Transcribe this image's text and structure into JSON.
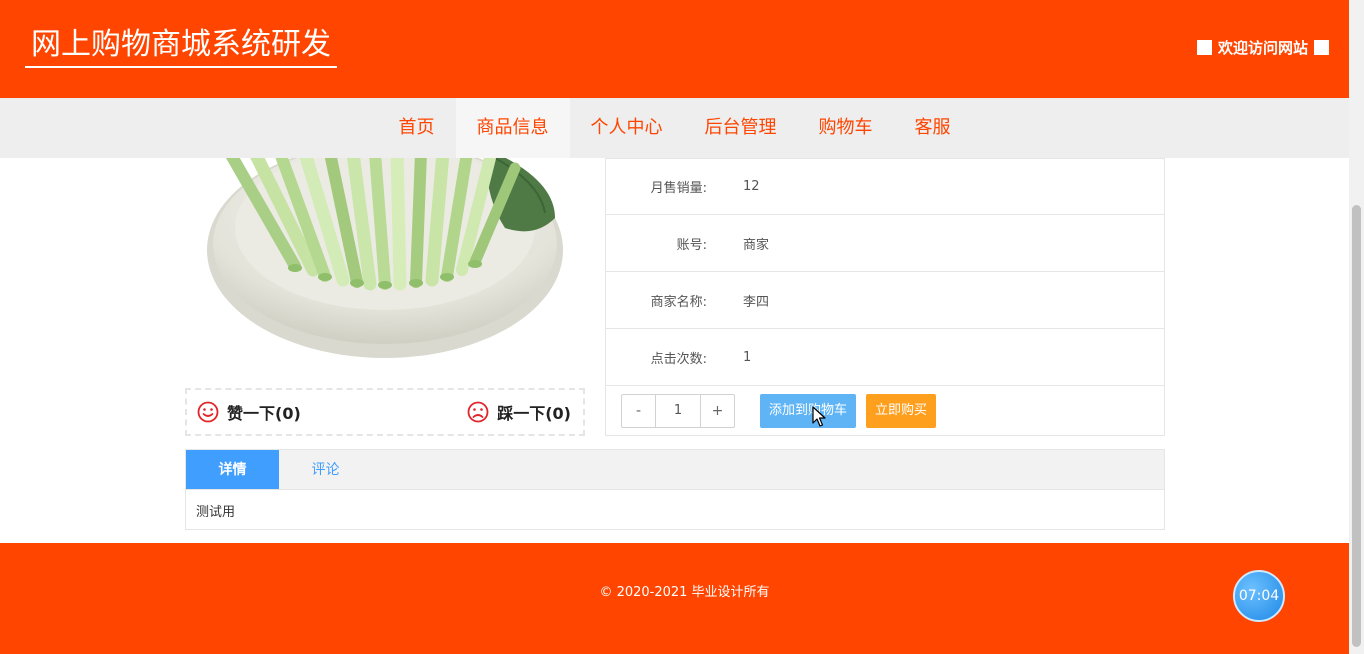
{
  "header": {
    "site_title": "网上购物商城系统研发",
    "welcome": "欢迎访问网站"
  },
  "nav": {
    "items": [
      {
        "label": "首页"
      },
      {
        "label": "商品信息"
      },
      {
        "label": "个人中心"
      },
      {
        "label": "后台管理"
      },
      {
        "label": "购物车"
      },
      {
        "label": "客服"
      }
    ],
    "active_index": 1
  },
  "product": {
    "image_icon": "bok-choy-photo",
    "likes_label": "赞一下(0)",
    "dislikes_label": "踩一下(0)",
    "info": [
      {
        "label": "月售销量:",
        "value": "12"
      },
      {
        "label": "账号:",
        "value": "商家"
      },
      {
        "label": "商家名称:",
        "value": "李四"
      },
      {
        "label": "点击次数:",
        "value": "1"
      }
    ],
    "quantity": {
      "minus": "-",
      "value": "1",
      "plus": "+"
    },
    "add_to_cart": "添加到购物车",
    "buy_now": "立即购买"
  },
  "tabs": {
    "items": [
      {
        "label": "详情"
      },
      {
        "label": "评论"
      }
    ],
    "active_index": 0,
    "content": "测试用"
  },
  "footer": {
    "copyright": "© 2020-2021 毕业设计所有"
  },
  "clock": {
    "time": "07:04"
  },
  "colors": {
    "brand": "#ff4500",
    "tab_active": "#409eff",
    "cart_button": "#5fb4f5",
    "buy_button": "#ff9f1e"
  }
}
